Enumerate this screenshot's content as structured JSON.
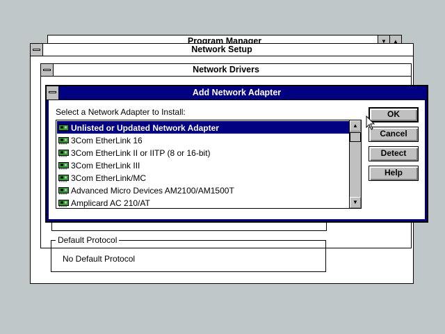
{
  "program_manager": {
    "title": "Program Manager"
  },
  "network_setup": {
    "title": "Network Setup"
  },
  "network_drivers": {
    "title": "Network Drivers"
  },
  "default_protocol": {
    "legend": "Default Protocol",
    "value": "No Default Protocol"
  },
  "add_adapter": {
    "title": "Add Network Adapter",
    "prompt": "Select a Network Adapter to Install:",
    "adapters": [
      "Unlisted or Updated Network Adapter",
      "3Com EtherLink 16",
      "3Com EtherLink II or IITP (8 or 16-bit)",
      "3Com EtherLink III",
      "3Com EtherLink/MC",
      "Advanced Micro Devices AM2100/AM1500T",
      "Amplicard AC 210/AT"
    ],
    "selected_index": 0,
    "buttons": {
      "ok": "OK",
      "cancel": "Cancel",
      "detect": "Detect",
      "help": "Help"
    }
  },
  "colors": {
    "desktop": "#c0c7c8",
    "active_title": "#000080",
    "selection": "#000080",
    "adapter_icon": "#2e9a2e"
  },
  "icons": {
    "adapter": "network-card-icon",
    "scroll_up": "arrow-up-icon",
    "scroll_down": "arrow-down-icon",
    "pointer": "mouse-pointer-icon"
  }
}
